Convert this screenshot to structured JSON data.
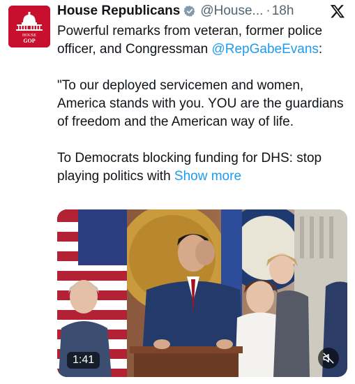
{
  "account": {
    "display_name": "House Republicans",
    "handle": "@House...",
    "separator": "·",
    "time": "18h",
    "avatar_text_top": "HOUSE",
    "avatar_text_bottom": "GOP",
    "avatar_color": "#c8102e",
    "verified_icon": "verified-badge-icon"
  },
  "tweet": {
    "line1_prefix": "Powerful remarks from veteran, former police officer, and Congressman ",
    "mention": "@RepGabeEvans",
    "line1_suffix": ":",
    "quote": "\"To our deployed servicemen and women, America stands with you. YOU are the guardians of freedom and the American way of life.",
    "line3_prefix": "To Democrats blocking funding for DHS: stop playing politics with ",
    "show_more": "Show more"
  },
  "media": {
    "duration": "1:41",
    "mute_icon": "muted-speaker-icon"
  },
  "colors": {
    "link": "#1d9bf0",
    "text": "#0f1419",
    "secondary": "#536471"
  }
}
